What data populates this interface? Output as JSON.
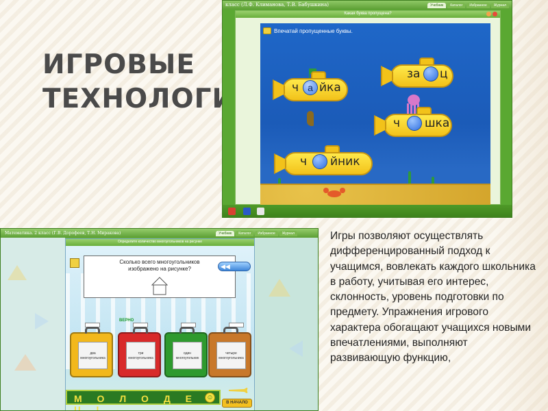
{
  "slide": {
    "title_line1": "ИГРОВЫЕ",
    "title_line2": "ТЕХНОЛОГИИ",
    "body": "Игры позволяют осуществлять дифференцированный подход к учащимся, вовлекать каждого школьника в работу, учитывая его интерес, склонность, уровень подготовки по предмету. Упражнения игрового характера обогащают учащихся новыми впечатлениями, выполняют развивающую функцию,"
  },
  "screenshot_top": {
    "book_title": "класс (Л.Ф. Климанова, Т.В. Бабушкина)",
    "tabs": [
      "Учебник",
      "Каталог",
      "Избранное",
      "Журнал"
    ],
    "window_title": "Какая буква пропущена?",
    "instruction": "Впечатай пропущенные буквы.",
    "submarines": [
      {
        "left": "ч",
        "letter": "а",
        "right": "йка"
      },
      {
        "left": "за",
        "letter": "",
        "right": "ц"
      },
      {
        "left": "ч",
        "letter": "",
        "right": "шка"
      },
      {
        "left": "ч",
        "letter": "",
        "right": "йник"
      }
    ]
  },
  "screenshot_bottom": {
    "book_title": "Математика. 2 класс (Г.В. Дорофеев, Т.Н. Миракова)",
    "tabs": [
      "Учебник",
      "Каталог",
      "Избранное",
      "Журнал"
    ],
    "window_title": "Определите количество многоугольников на рисунке",
    "question": "Сколько всего многоугольников изображено на рисунке?",
    "feedback": "ВЕРНО",
    "answers": [
      "два многоугольника",
      "три многоугольника",
      "один многоугольник",
      "четыре многоугольника"
    ],
    "suitcase_colors": [
      "#f2b81c",
      "#d82a2a",
      "#2e9a2e",
      "#c8782a"
    ],
    "praise": "М О Л О Д Е Ц !",
    "restart_button": "В НАЧАЛО"
  }
}
